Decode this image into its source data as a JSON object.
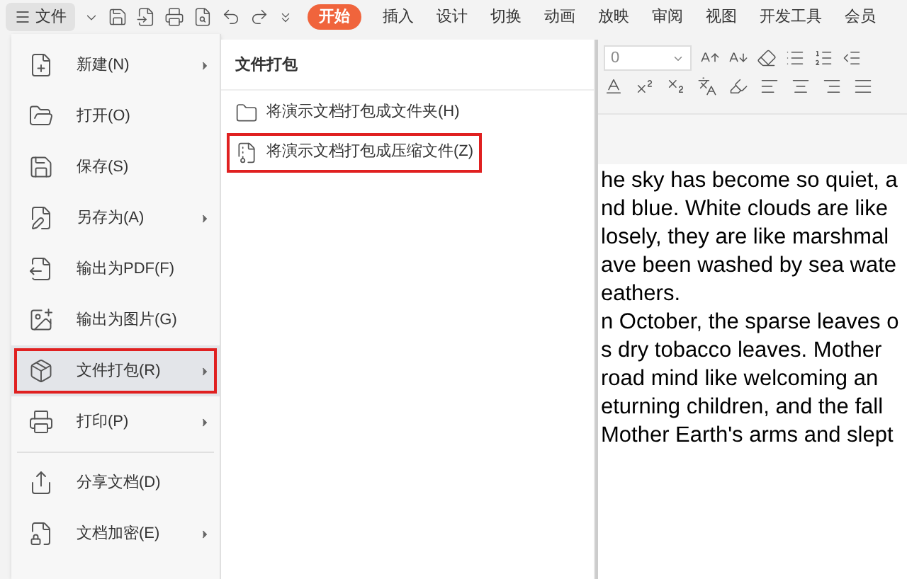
{
  "file_button": {
    "label": "文件"
  },
  "ribbon_tabs": [
    {
      "label": "开始",
      "selected": true
    },
    {
      "label": "插入",
      "selected": false
    },
    {
      "label": "设计",
      "selected": false
    },
    {
      "label": "切换",
      "selected": false
    },
    {
      "label": "动画",
      "selected": false
    },
    {
      "label": "放映",
      "selected": false
    },
    {
      "label": "审阅",
      "selected": false
    },
    {
      "label": "视图",
      "selected": false
    },
    {
      "label": "开发工具",
      "selected": false
    },
    {
      "label": "会员",
      "selected": false
    }
  ],
  "file_menu": [
    {
      "label": "新建(N)",
      "kind": "new",
      "submenu": true,
      "selected": false,
      "highlighted": false
    },
    {
      "label": "打开(O)",
      "kind": "open",
      "submenu": false,
      "selected": false,
      "highlighted": false
    },
    {
      "label": "保存(S)",
      "kind": "save",
      "submenu": false,
      "selected": false,
      "highlighted": false
    },
    {
      "label": "另存为(A)",
      "kind": "saveas",
      "submenu": true,
      "selected": false,
      "highlighted": false
    },
    {
      "label": "输出为PDF(F)",
      "kind": "pdf",
      "submenu": false,
      "selected": false,
      "highlighted": false
    },
    {
      "label": "输出为图片(G)",
      "kind": "image",
      "submenu": false,
      "selected": false,
      "highlighted": false
    },
    {
      "label": "文件打包(R)",
      "kind": "pack",
      "submenu": true,
      "selected": true,
      "highlighted": true
    },
    {
      "label": "打印(P)",
      "kind": "print",
      "submenu": true,
      "selected": false,
      "highlighted": false
    },
    {
      "label": "分享文档(D)",
      "kind": "share",
      "submenu": false,
      "selected": false,
      "highlighted": false,
      "divider_before": true
    },
    {
      "label": "文档加密(E)",
      "kind": "encrypt",
      "submenu": true,
      "selected": false,
      "highlighted": false
    }
  ],
  "submenu": {
    "title": "文件打包",
    "items": [
      {
        "label": "将演示文档打包成文件夹(H)",
        "kind": "folder",
        "highlighted": false
      },
      {
        "label": "将演示文档打包成压缩文件(Z)",
        "kind": "zip",
        "highlighted": true
      }
    ]
  },
  "font_size": {
    "value": "0"
  },
  "document_lines": [
    "he sky has become so quiet, a",
    "nd blue. White clouds are like",
    "losely, they are like marshmal",
    "ave been washed by sea wate",
    "eathers.",
    "n October, the sparse leaves o",
    "s dry tobacco leaves. Mother",
    "road mind like welcoming an",
    "eturning children, and the fall",
    "Mother Earth's arms and slept"
  ]
}
